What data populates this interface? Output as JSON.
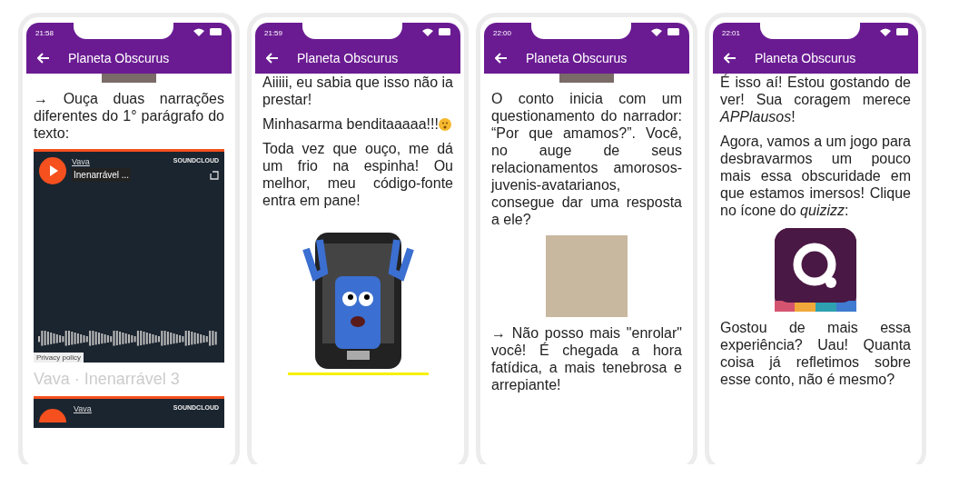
{
  "phones": [
    {
      "time": "21:58",
      "title": "Planeta Obscurus",
      "blocks": [
        {
          "kind": "photo_strip"
        },
        {
          "kind": "paragraph",
          "text": "→ Ouça duas narrações diferentes do 1° parágrafo do texto:"
        },
        {
          "kind": "soundcloud",
          "artist": "Vava",
          "track": "Inenarrável ...",
          "brand": "SOUNDCLOUD",
          "privacy": "Privacy policy"
        },
        {
          "kind": "caption",
          "text": "Vava · Inenarrável 3"
        },
        {
          "kind": "soundcloud_partial",
          "artist": "Vava",
          "brand": "SOUNDCLOUD"
        }
      ]
    },
    {
      "time": "21:59",
      "title": "Planeta Obscurus",
      "blocks": [
        {
          "kind": "paragraph",
          "text": "Aiiiii, eu sabia que isso não ia prestar!"
        },
        {
          "kind": "paragraph_emoji",
          "text": "Minhasarma benditaaaaa!!!"
        },
        {
          "kind": "paragraph",
          "text": "Toda vez que ouço, me dá um frio na espinha! Ou melhor, meu código-fonte entra em pane!"
        },
        {
          "kind": "phone_drawing"
        }
      ]
    },
    {
      "time": "22:00",
      "title": "Planeta Obscurus",
      "blocks": [
        {
          "kind": "photo_strip"
        },
        {
          "kind": "paragraph",
          "text": "O conto inicia com um questionamento do narrador: “Por que amamos?”. Você, no auge de seus relacionamentos amorosos-juvenis-avatarianos, consegue dar uma resposta a ele?"
        },
        {
          "kind": "photo"
        },
        {
          "kind": "paragraph",
          "text": "→ Não posso mais \"enrolar\" você! É chegada a hora fatídica, a mais tenebrosa e arrepiante!"
        }
      ]
    },
    {
      "time": "22:01",
      "title": "Planeta Obscurus",
      "blocks": [
        {
          "kind": "paragraph",
          "text": "É isso aí! Estou gostando de ver! Sua coragem merece *APPlausos*!"
        },
        {
          "kind": "paragraph",
          "text": "Agora, vamos a um jogo para desbravarmos um pouco mais essa obscuridade em que estamos imersos! Clique no ícone do *quizizz*:"
        },
        {
          "kind": "quiz_logo"
        },
        {
          "kind": "paragraph",
          "text": "Gostou de mais essa experiência? Uau! Quanta coisa já refletimos sobre esse conto, não é mesmo?"
        }
      ]
    }
  ]
}
